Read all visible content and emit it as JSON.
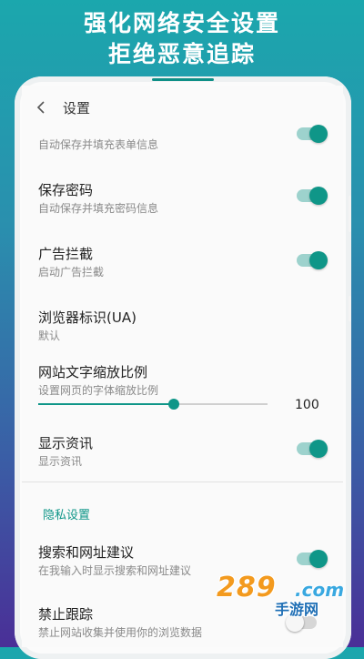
{
  "promo": {
    "line1": "强化网络安全设置",
    "line2": "拒绝恶意追踪"
  },
  "header": {
    "back_icon": "chevron-left-icon",
    "title": "设置"
  },
  "settings": {
    "autofill_partial": {
      "subtitle": "自动保存并填充表单信息",
      "enabled": true
    },
    "save_password": {
      "title": "保存密码",
      "subtitle": "自动保存并填充密码信息",
      "enabled": true
    },
    "ad_block": {
      "title": "广告拦截",
      "subtitle": "启动广告拦截",
      "enabled": true
    },
    "user_agent": {
      "title": "浏览器标识(UA)",
      "subtitle": "默认"
    },
    "text_scale": {
      "title": "网站文字缩放比例",
      "subtitle": "设置网页的字体缩放比例",
      "value": "100",
      "fraction": 0.59
    },
    "show_news": {
      "title": "显示资讯",
      "subtitle": "显示资讯",
      "enabled": true
    }
  },
  "privacy": {
    "section_title": "隐私设置",
    "search_suggest": {
      "title": "搜索和网址建议",
      "subtitle": "在我输入时显示搜索和网址建议",
      "enabled": true
    },
    "do_not_track": {
      "title": "禁止跟踪",
      "subtitle": "禁止网站收集并使用你的浏览数据",
      "enabled": false
    }
  },
  "watermark": {
    "number": "289",
    "suffix": ".com",
    "cn": "手游网"
  },
  "colors": {
    "accent": "#0f9688",
    "toggle_track_on": "#9dd2cd",
    "background_gradient_top": "#1ba7ad",
    "background_gradient_bottom": "#4a2f97"
  }
}
